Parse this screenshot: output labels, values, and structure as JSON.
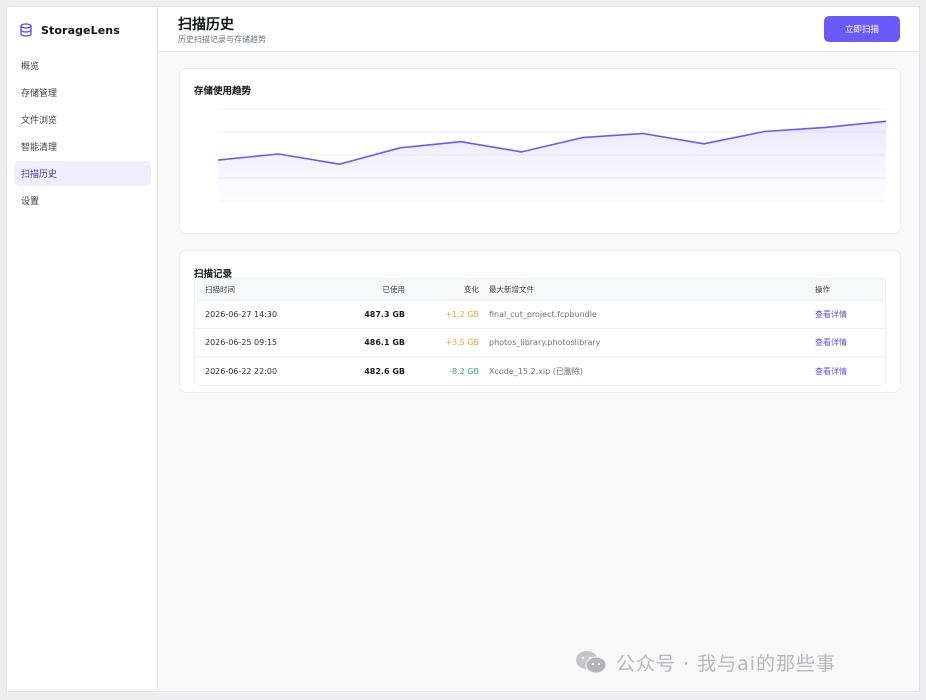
{
  "app": {
    "brand": "StorageLens",
    "brand_icon": "database-icon",
    "accent": "#6a5af9"
  },
  "sidebar": {
    "items": [
      {
        "label": "概览",
        "active": false
      },
      {
        "label": "存储管理",
        "active": false
      },
      {
        "label": "文件浏览",
        "active": false
      },
      {
        "label": "智能清理",
        "active": false
      },
      {
        "label": "扫描历史",
        "active": true
      },
      {
        "label": "设置",
        "active": false
      }
    ]
  },
  "header": {
    "title": "扫描历史",
    "subtitle": "历史扫描记录与存储趋势",
    "scan_button": "立即扫描"
  },
  "trend": {
    "title": "存储使用趋势",
    "chart_data": {
      "type": "area",
      "x": [
        1,
        2,
        3,
        4,
        5,
        6,
        7,
        8,
        9,
        10,
        11,
        12
      ],
      "values": [
        470,
        473,
        468,
        476,
        479,
        474,
        481,
        483,
        478,
        484,
        486,
        489
      ],
      "ylim": [
        450,
        495
      ],
      "grid": true,
      "line_color": "#6a5af9"
    }
  },
  "records": {
    "title": "扫描记录",
    "columns": {
      "time": "扫描时间",
      "used": "已使用",
      "change": "变化",
      "file": "最大新增文件",
      "action": "操作"
    },
    "rows": [
      {
        "time": "2026-06-27 14:30",
        "used": "487.3 GB",
        "change": "+1.2 GB",
        "change_type": "increase",
        "file": "final_cut_project.fcpbundle",
        "action": "查看详情"
      },
      {
        "time": "2026-06-25 09:15",
        "used": "486.1 GB",
        "change": "+3.5 GB",
        "change_type": "increase",
        "file": "photos_library.photoslibrary",
        "action": "查看详情"
      },
      {
        "time": "2026-06-22 22:00",
        "used": "482.6 GB",
        "change": "-8.2 GB",
        "change_type": "decrease",
        "file": "Xcode_15.2.xip (已删除)",
        "action": "查看详情"
      }
    ]
  },
  "watermark": {
    "text": "公众号 · 我与ai的那些事",
    "icon": "wechat-icon"
  }
}
